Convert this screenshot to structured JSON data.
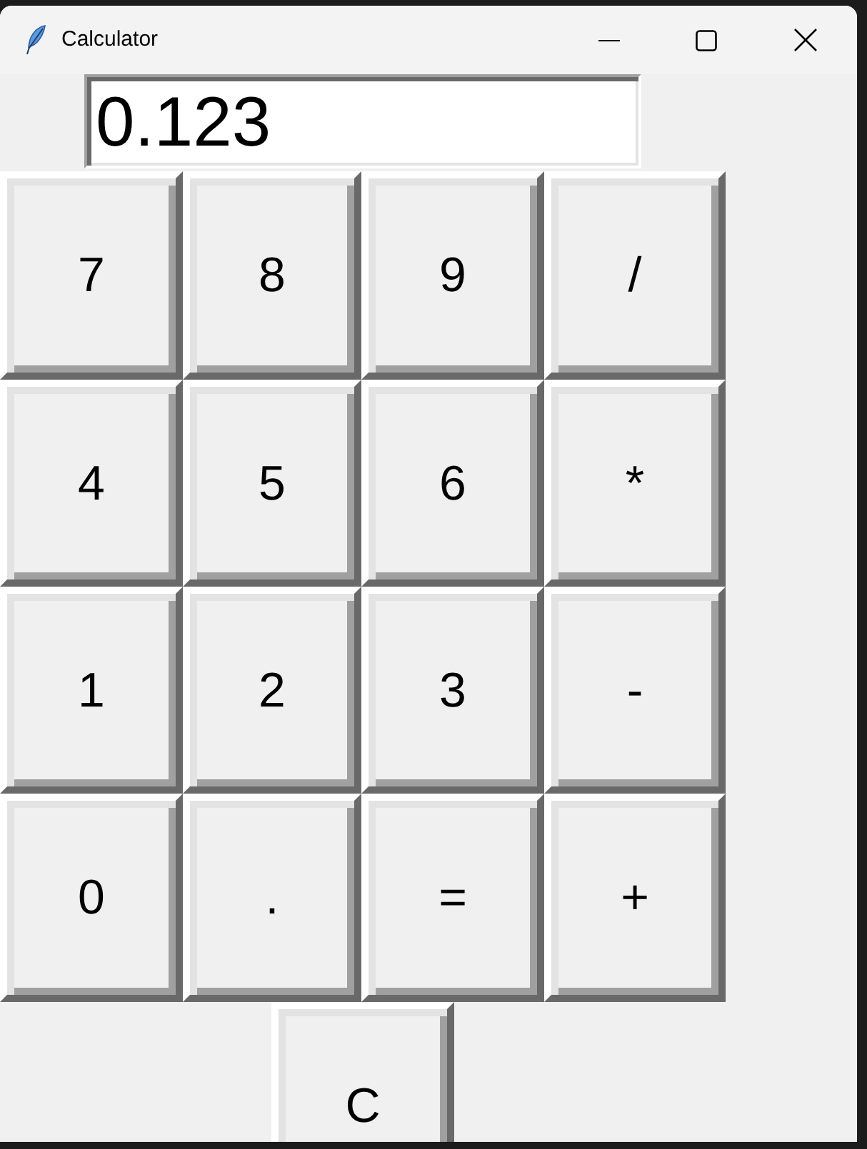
{
  "window": {
    "title": "Calculator"
  },
  "display": {
    "value": "0.123"
  },
  "keypad": {
    "rows": [
      [
        "7",
        "8",
        "9",
        "/"
      ],
      [
        "4",
        "5",
        "6",
        "*"
      ],
      [
        "1",
        "2",
        "3",
        "-"
      ],
      [
        "0",
        ".",
        "=",
        "+"
      ]
    ]
  },
  "clear_button": {
    "label": "C"
  }
}
